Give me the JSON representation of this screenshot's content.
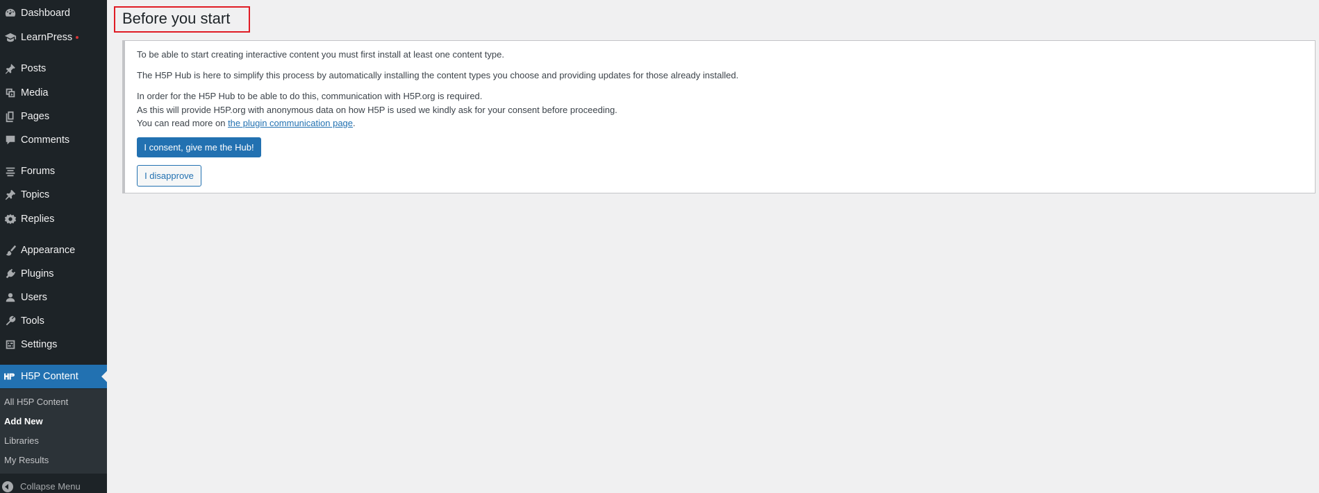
{
  "sidebar": {
    "items": [
      {
        "label": "Dashboard",
        "icon": "dashboard-icon"
      },
      {
        "label": "LearnPress",
        "icon": "learnpress-icon"
      },
      {
        "label": "Posts",
        "icon": "pin-icon"
      },
      {
        "label": "Media",
        "icon": "media-icon"
      },
      {
        "label": "Pages",
        "icon": "pages-icon"
      },
      {
        "label": "Comments",
        "icon": "comment-icon"
      },
      {
        "label": "Forums",
        "icon": "forums-icon"
      },
      {
        "label": "Topics",
        "icon": "topics-icon"
      },
      {
        "label": "Replies",
        "icon": "replies-icon"
      },
      {
        "label": "Appearance",
        "icon": "brush-icon"
      },
      {
        "label": "Plugins",
        "icon": "plug-icon"
      },
      {
        "label": "Users",
        "icon": "user-icon"
      },
      {
        "label": "Tools",
        "icon": "wrench-icon"
      },
      {
        "label": "Settings",
        "icon": "settings-icon"
      },
      {
        "label": "H5P Content",
        "icon": "h5p-icon"
      }
    ],
    "submenu": [
      {
        "label": "All H5P Content"
      },
      {
        "label": "Add New"
      },
      {
        "label": "Libraries"
      },
      {
        "label": "My Results"
      }
    ],
    "collapse_label": "Collapse Menu"
  },
  "main": {
    "title": "Before you start",
    "notice": {
      "p1": "To be able to start creating interactive content you must first install at least one content type.",
      "p2": "The H5P Hub is here to simplify this process by automatically installing the content types you choose and providing updates for those already installed.",
      "p3_line1": "In order for the H5P Hub to be able to do this, communication with H5P.org is required.",
      "p3_line2": "As this will provide H5P.org with anonymous data on how H5P is used we kindly ask for your consent before proceeding.",
      "p3_line3_prefix": "You can read more on ",
      "p3_link": "the plugin communication page",
      "p3_line3_suffix": ".",
      "consent_button": "I consent, give me the Hub!",
      "disapprove_button": "I disapprove"
    }
  },
  "colors": {
    "sidebar_bg": "#1d2327",
    "submenu_bg": "#2c3338",
    "accent": "#2271b1",
    "highlight_border": "#e01b24",
    "notification_dot": "#d63638"
  }
}
